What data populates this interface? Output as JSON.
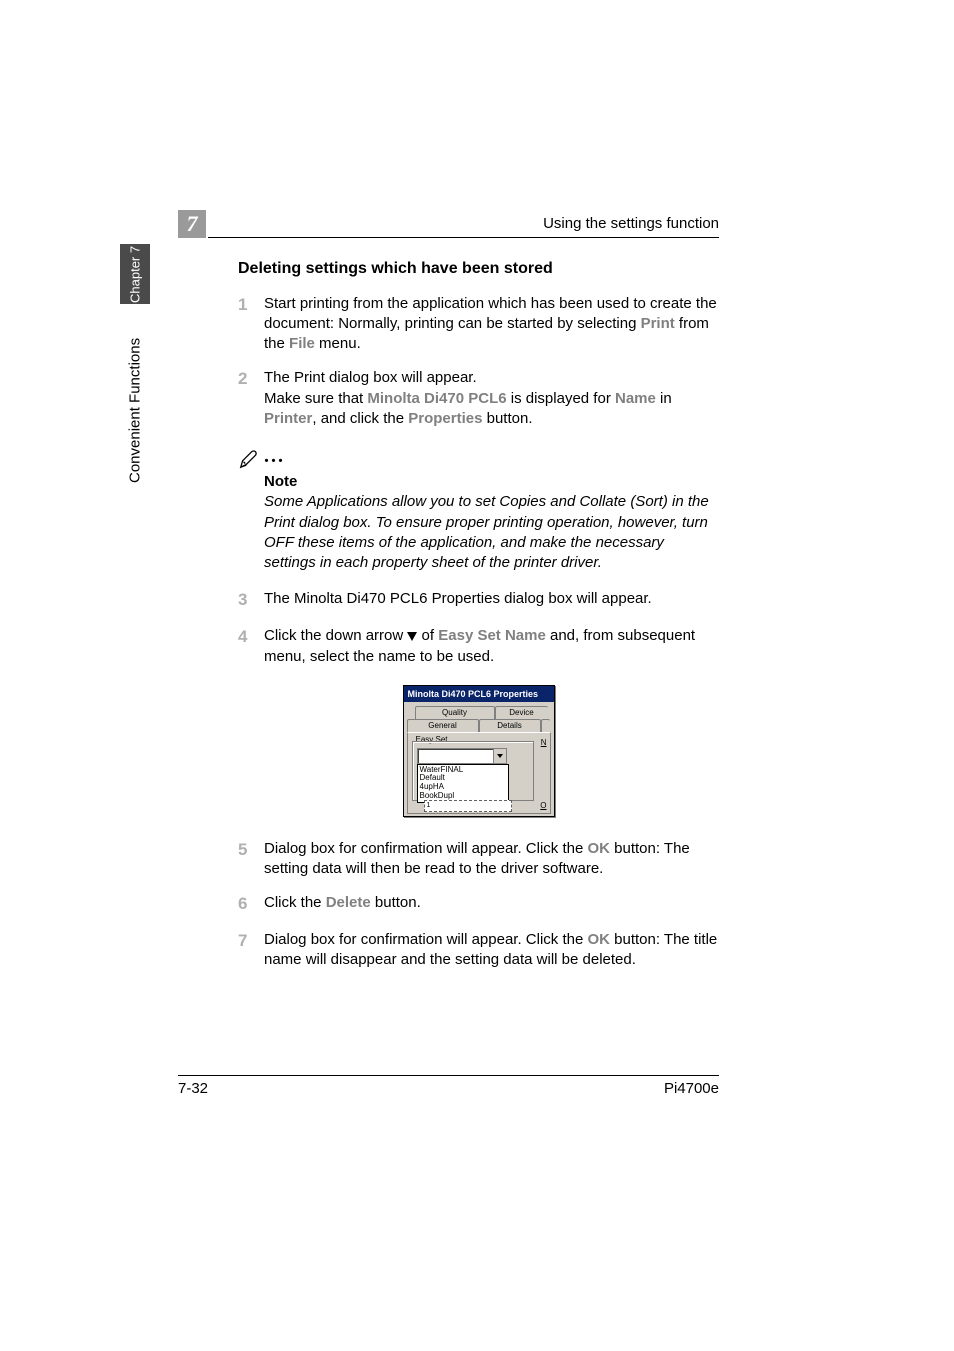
{
  "header": {
    "running": "Using the settings function",
    "chapter_number": "7"
  },
  "sidebar": {
    "tab": "Chapter 7",
    "label": "Convenient Functions"
  },
  "section_title": "Deleting settings which have been stored",
  "steps": {
    "s1": {
      "num": "1",
      "pre": "Start printing from the application which has been used to create the document: Normally, printing can be started by selecting ",
      "g1": "Print",
      "mid": " from the ",
      "g2": "File",
      "post": " menu."
    },
    "s2": {
      "num": "2",
      "line1": "The Print dialog box will appear.",
      "l2a": "Make sure that ",
      "l2b": "Minolta Di470 PCL6",
      "l2c": " is displayed for ",
      "l2d": "Name",
      "l2e": " in ",
      "l2f": "Printer",
      "l2g": ", and click the ",
      "l2h": "Properties",
      "l2i": " button."
    },
    "note": {
      "label": "Note",
      "text": "Some Applications allow you to set Copies and Collate (Sort) in the Print dialog box. To ensure proper printing operation, however, turn OFF these items of the application, and make the necessary settings in each property sheet of the printer driver."
    },
    "s3": {
      "num": "3",
      "text": "The Minolta Di470 PCL6 Properties dialog box will appear."
    },
    "s4": {
      "num": "4",
      "pre": "Click the down arrow ",
      "mid": " of ",
      "g1": "Easy Set Name",
      "post": " and, from subsequent menu, select the name to be used."
    },
    "s5": {
      "num": "5",
      "pre": "Dialog box for confirmation will appear. Click the ",
      "g1": "OK",
      "post": " button: The setting data will then be read to the driver software."
    },
    "s6": {
      "num": "6",
      "pre": "Click the ",
      "g1": "Delete",
      "post": " button."
    },
    "s7": {
      "num": "7",
      "pre": "Dialog box for confirmation will appear. Click the ",
      "g1": "OK",
      "post": " button: The title name will disappear and the setting data will be deleted."
    }
  },
  "dialog": {
    "title": "Minolta Di470 PCL6 Properties",
    "tabs_upper": [
      "Quality",
      "Device"
    ],
    "tabs_lower": [
      "General",
      "Details",
      ""
    ],
    "group_label": "Easy Set",
    "right_char_top": "N",
    "right_char_bottom": "O",
    "list": [
      "WaterFINAL",
      "Default",
      "4upHA",
      "BookDupl"
    ],
    "dashed_value": "1"
  },
  "footer": {
    "left": "7-32",
    "right": "Pi4700e"
  }
}
